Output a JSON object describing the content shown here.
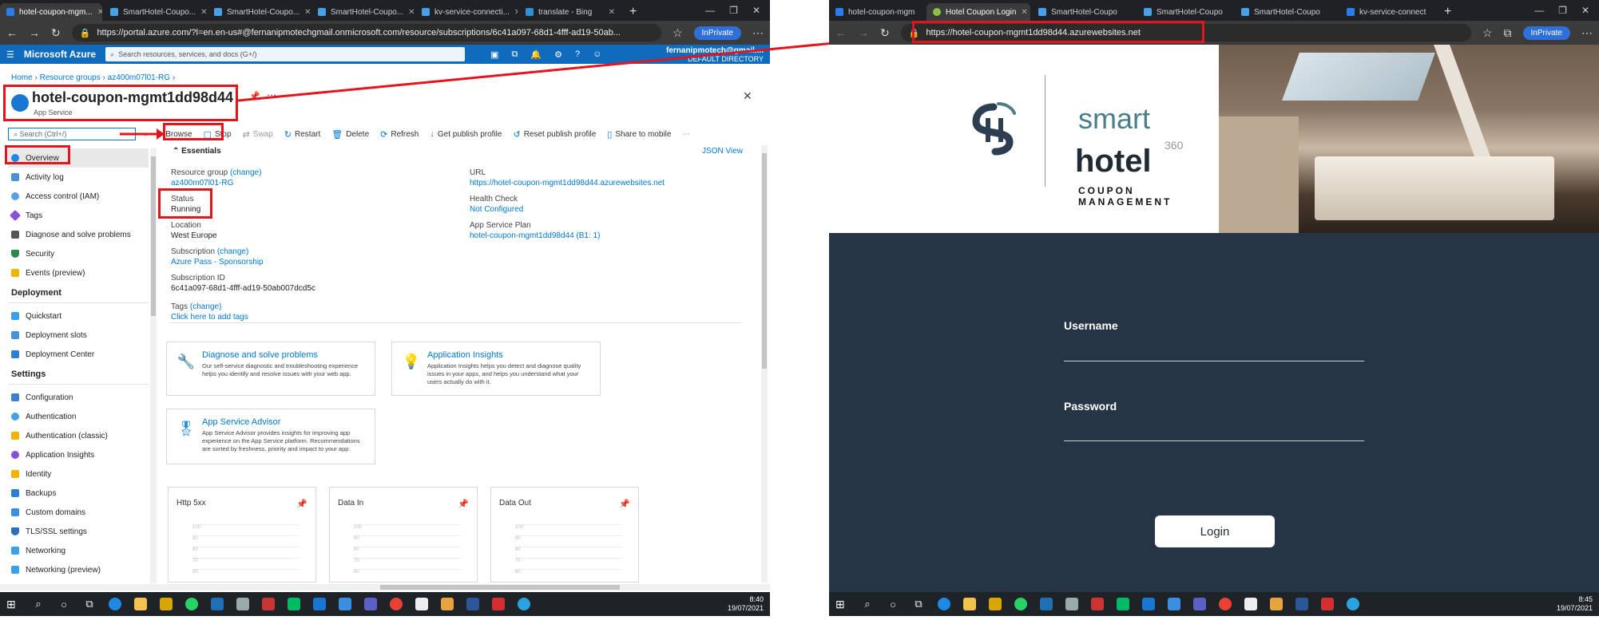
{
  "left": {
    "tabs": [
      "hotel-coupon-mgm...",
      "SmartHotel-Coupo...",
      "SmartHotel-Coupo...",
      "SmartHotel-Coupo...",
      "kv-service-connecti...",
      "translate - Bing"
    ],
    "url": "https://portal.azure.com/?l=en.en-us#@fernanipmotechgmail.onmicrosoft.com/resource/subscriptions/6c41a097-68d1-4fff-ad19-50ab...",
    "inprivate": "InPrivate",
    "portal": {
      "brand": "Microsoft Azure",
      "search_placeholder": "Search resources, services, and docs (G+/)",
      "user_email": "fernanipmotech@gmail....",
      "user_dir": "DEFAULT DIRECTORY"
    },
    "breadcrumb": [
      "Home",
      "Resource groups",
      "az400m07l01-RG"
    ],
    "title": "hotel-coupon-mgmt1dd98d44",
    "subtitle": "App Service",
    "toolbar": {
      "search": "Search (Ctrl+/)",
      "items": [
        "Browse",
        "Stop",
        "Swap",
        "Restart",
        "Delete",
        "Refresh",
        "Get publish profile",
        "Reset publish profile",
        "Share to mobile"
      ]
    },
    "nav": {
      "top": [
        "Overview",
        "Activity log",
        "Access control (IAM)",
        "Tags",
        "Diagnose and solve problems",
        "Security",
        "Events (preview)"
      ],
      "deployment_head": "Deployment",
      "deployment": [
        "Quickstart",
        "Deployment slots",
        "Deployment Center"
      ],
      "settings_head": "Settings",
      "settings": [
        "Configuration",
        "Authentication",
        "Authentication (classic)",
        "Application Insights",
        "Identity",
        "Backups",
        "Custom domains",
        "TLS/SSL settings",
        "Networking",
        "Networking (preview)"
      ]
    },
    "essentials": {
      "head": "Essentials",
      "json_view": "JSON View",
      "rg_label": "Resource group",
      "change": "(change)",
      "rg_value": "az400m07l01-RG",
      "status_label": "Status",
      "status_value": "Running",
      "location_label": "Location",
      "location_value": "West Europe",
      "sub_label": "Subscription",
      "sub_value": "Azure Pass - Sponsorship",
      "subid_label": "Subscription ID",
      "subid_value": "6c41a097-68d1-4fff-ad19-50ab007dcd5c",
      "tags_label": "Tags",
      "tags_value": "Click here to add tags",
      "url_label": "URL",
      "url_value": "https://hotel-coupon-mgmt1dd98d44.azurewebsites.net",
      "health_label": "Health Check",
      "health_value": "Not Configured",
      "plan_label": "App Service Plan",
      "plan_value": "hotel-coupon-mgmt1dd98d44 (B1: 1)"
    },
    "cards": [
      {
        "title": "Diagnose and solve problems",
        "desc": "Our self-service diagnostic and troubleshooting experience helps you identify and resolve issues with your web app."
      },
      {
        "title": "Application Insights",
        "desc": "Application Insights helps you detect and diagnose quality issues in your apps, and helps you understand what your users actually do with it."
      },
      {
        "title": "App Service Advisor",
        "desc": "App Service Advisor provides insights for improving app experience on the App Service platform. Recommendations are sorted by freshness, priority and impact to your app."
      }
    ],
    "tiles": [
      "Http 5xx",
      "Data In",
      "Data Out"
    ],
    "tile_ticks": [
      "100",
      "90",
      "80",
      "70",
      "60"
    ],
    "clock_time": "8:40",
    "clock_date": "19/07/2021"
  },
  "right": {
    "tabs": [
      "hotel-coupon-mgm",
      "Hotel Coupon Login",
      "SmartHotel-Coupo",
      "SmartHotel-Coupo",
      "SmartHotel-Coupo",
      "kv-service-connect"
    ],
    "url": "https://hotel-coupon-mgmt1dd98d44.azurewebsites.net",
    "inprivate": "InPrivate",
    "logo": {
      "smart": "smart",
      "hotel": "hotel",
      "n360": "360",
      "coupon1": "COUPON",
      "coupon2": "MANAGEMENT"
    },
    "username_label": "Username",
    "password_label": "Password",
    "login_label": "Login",
    "clock_time": "8:45",
    "clock_date": "19/07/2021"
  },
  "colors": {
    "azure_blue": "#0f6cbd",
    "highlight_red": "#e3141b",
    "login_panel": "#263545"
  }
}
